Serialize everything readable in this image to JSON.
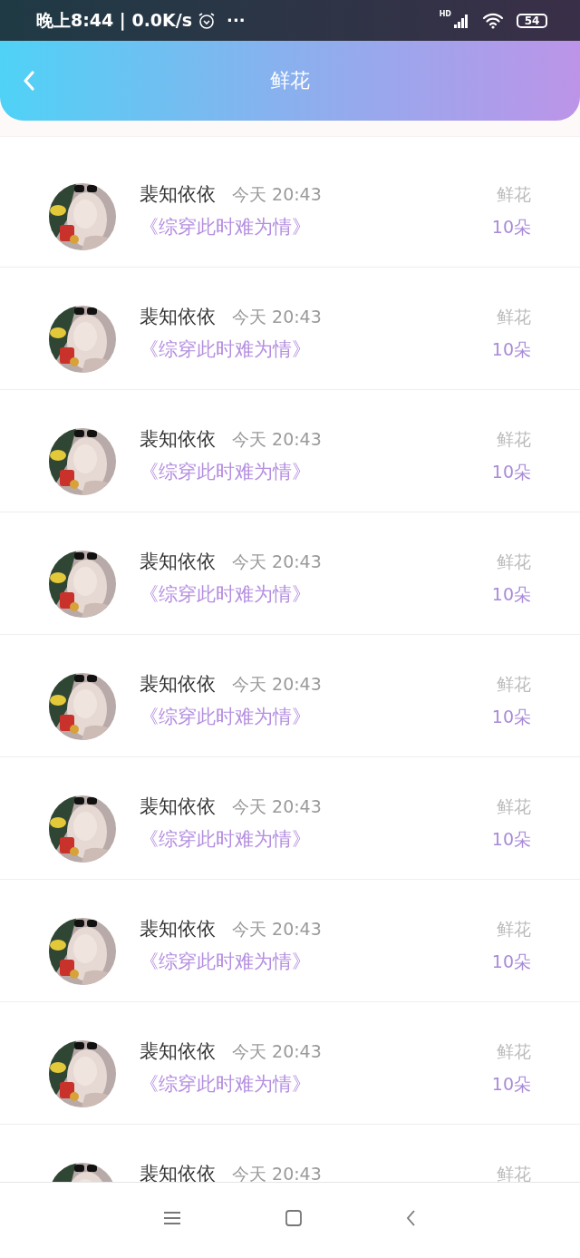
{
  "status_bar": {
    "time": "晚上8:44 | 0.0K/s",
    "more": "···",
    "network_label": "HD",
    "battery": "54"
  },
  "header": {
    "title": "鲜花"
  },
  "records": [
    {
      "name": "裴知依依",
      "time": "今天 20:43",
      "book": "《综穿此时难为情》",
      "type": "鲜花",
      "amount": "10朵"
    },
    {
      "name": "裴知依依",
      "time": "今天 20:43",
      "book": "《综穿此时难为情》",
      "type": "鲜花",
      "amount": "10朵"
    },
    {
      "name": "裴知依依",
      "time": "今天 20:43",
      "book": "《综穿此时难为情》",
      "type": "鲜花",
      "amount": "10朵"
    },
    {
      "name": "裴知依依",
      "time": "今天 20:43",
      "book": "《综穿此时难为情》",
      "type": "鲜花",
      "amount": "10朵"
    },
    {
      "name": "裴知依依",
      "time": "今天 20:43",
      "book": "《综穿此时难为情》",
      "type": "鲜花",
      "amount": "10朵"
    },
    {
      "name": "裴知依依",
      "time": "今天 20:43",
      "book": "《综穿此时难为情》",
      "type": "鲜花",
      "amount": "10朵"
    },
    {
      "name": "裴知依依",
      "time": "今天 20:43",
      "book": "《综穿此时难为情》",
      "type": "鲜花",
      "amount": "10朵"
    },
    {
      "name": "裴知依依",
      "time": "今天 20:43",
      "book": "《综穿此时难为情》",
      "type": "鲜花",
      "amount": "10朵"
    },
    {
      "name": "裴知依依",
      "time": "今天 20:43",
      "type": "鲜花"
    }
  ]
}
